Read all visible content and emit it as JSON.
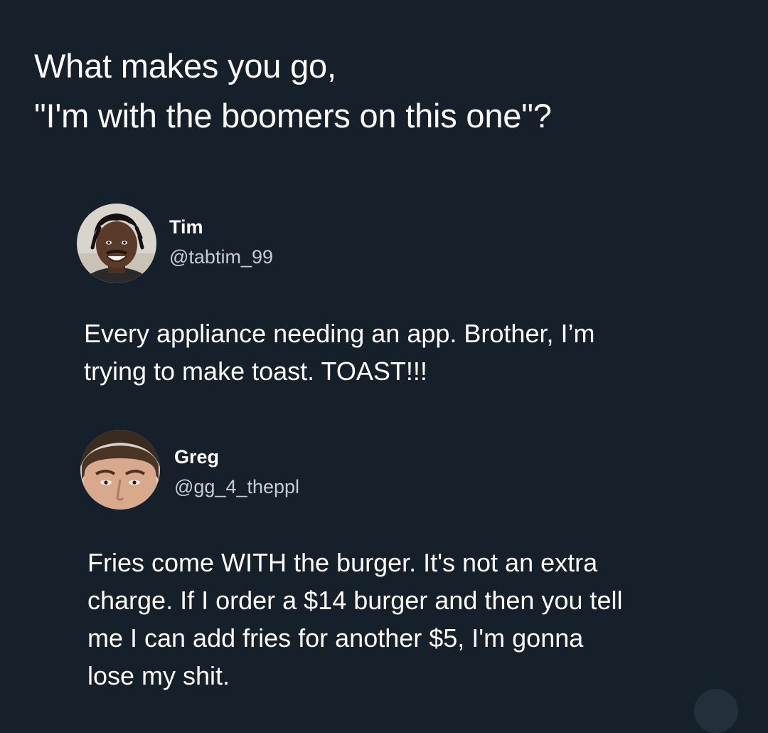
{
  "question": {
    "lines": [
      "What makes you go,",
      "\"I'm with the boomers on this one\"?"
    ]
  },
  "replies": [
    {
      "name": "Tim",
      "handle": "@tabtim_99",
      "avatar": "avatar-photo-smiling-man",
      "lines": [
        "Every appliance needing an app. Brother, I’m",
        "trying to make toast. TOAST!!!"
      ]
    },
    {
      "name": "Greg",
      "handle": "@gg_4_theppl",
      "avatar": "avatar-photo-man-face-close-up",
      "lines": [
        "Fries come WITH the burger. It's not an extra",
        "charge. If I order a $14 burger and then you tell",
        "me I can add fries for another $5, I'm gonna",
        "lose my shit."
      ]
    }
  ],
  "colors": {
    "background": "#16202a",
    "text": "#ffffff",
    "handle_text": "#c4ccd4"
  }
}
